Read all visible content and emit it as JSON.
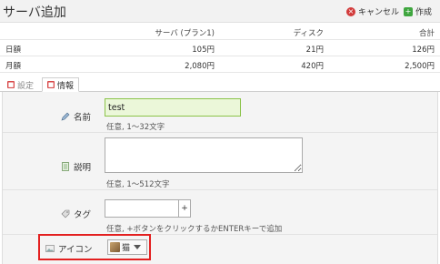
{
  "header": {
    "title": "サーバ追加",
    "cancel_label": "キャンセル",
    "create_label": "作成"
  },
  "price_table": {
    "headers": [
      "",
      "サーバ (プラン1)",
      "ディスク",
      "合計"
    ],
    "rows": [
      {
        "label": "日額",
        "server": "105円",
        "disk": "21円",
        "total": "126円"
      },
      {
        "label": "月額",
        "server": "2,080円",
        "disk": "420円",
        "total": "2,500円"
      }
    ]
  },
  "tabs": [
    {
      "label": "設定",
      "active": false
    },
    {
      "label": "情報",
      "active": true
    }
  ],
  "form": {
    "name": {
      "label": "名前",
      "value": "test",
      "help": "任意, 1〜32文字"
    },
    "description": {
      "label": "説明",
      "value": "",
      "help": "任意, 1〜512文字"
    },
    "tag": {
      "label": "タグ",
      "value": "",
      "plus": "+",
      "help": "任意, +ボタンをクリックするかENTERキーで追加"
    },
    "icon": {
      "label": "アイコン",
      "selected": "猫"
    }
  },
  "colors": {
    "highlight_border": "#e32020",
    "name_field_bg": "#ebf7d9",
    "cancel_icon": "#d23b3b",
    "create_icon": "#3fa63f"
  }
}
